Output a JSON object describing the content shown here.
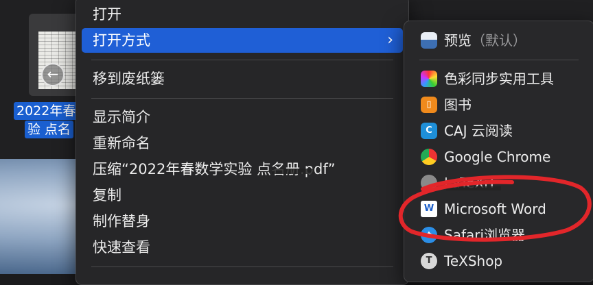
{
  "finder": {
    "file_label_line1": "2022年春",
    "file_label_line2": "验 点名"
  },
  "context_menu": {
    "open": "打开",
    "open_with": "打开方式",
    "move_to_trash": "移到废纸篓",
    "get_info": "显示简介",
    "rename": "重新命名",
    "compress": "压缩“2022年春数学实验 点名册.pdf”",
    "duplicate": "复制",
    "make_alias": "制作替身",
    "quick_look": "快速查看",
    "chevron": "›"
  },
  "open_with_menu": {
    "preview": "预览",
    "preview_default": "（默认）",
    "apps": [
      "色彩同步实用工具",
      "图书",
      "CAJ 云阅读",
      "Google Chrome",
      "LaTeXiT",
      "Microsoft Word",
      "Safari浏览器",
      "TeXShop"
    ]
  },
  "colors": {
    "selection": "#1f5fd6",
    "annotation": "#e2262a"
  }
}
